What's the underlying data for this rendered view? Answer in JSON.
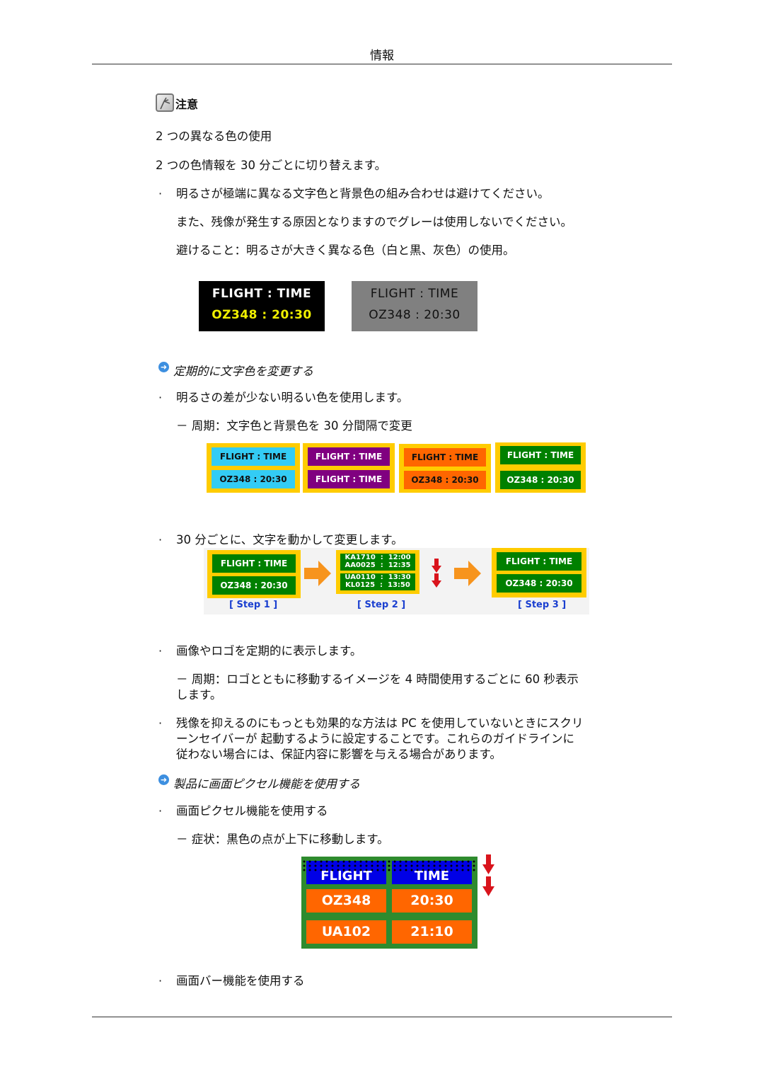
{
  "header": {
    "title": "情報"
  },
  "note": {
    "icon": "note-pencil-icon",
    "label": "注意"
  },
  "intro": {
    "line1": "2 つの異なる色の使用",
    "line2": "2 つの色情報を 30 分ごとに切り替えます。"
  },
  "avoid": {
    "bullet": "·",
    "line1": "明るさが極端に異なる文字色と背景色の組み合わせは避けてください。",
    "line2": "また、残像が発生する原因となりますのでグレーは使用しないでください。",
    "line3": "避けること：明るさが大きく異なる色（白と黒、灰色）の使用。"
  },
  "bad_examples": [
    {
      "row1": "FLIGHT  :  TIME",
      "row2": "OZ348    :  20:30",
      "bg": "#000000",
      "row1_color": "#ffffff",
      "row2_color": "#f0f000"
    },
    {
      "row1": "FLIGHT  :  TIME",
      "row2": "OZ348    :  20:30",
      "bg": "#808080",
      "row1_color": "#111111",
      "row2_color": "#111111"
    }
  ],
  "section1": {
    "icon": "arrow-right-circle-icon",
    "title": "定期的に文字色を変更する",
    "bullet": "·",
    "item": "明るさの差が少ない明るい色を使用します。",
    "sub": "－ 周期：文字色と背景色を 30 分間隔で変更"
  },
  "color_boards": [
    {
      "top": "FLIGHT  :  TIME",
      "bottom": "OZ348    :  20:30",
      "bg": "#33ccf5",
      "fg": "#111111"
    },
    {
      "top": "FLIGHT  :  TIME",
      "bottom": "FLIGHT  :  TIME",
      "bg": "#800080",
      "fg": "#ffffff"
    },
    {
      "top": "FLIGHT  :  TIME",
      "bottom": "OZ348    :  20:30",
      "bg": "#ff6600",
      "fg": "#111111"
    },
    {
      "top": "FLIGHT  :  TIME",
      "bottom": "OZ348    :  20:30",
      "bg": "#008000",
      "fg": "#ffffff"
    }
  ],
  "move": {
    "bullet": "·",
    "item": "30 分ごとに、文字を動かして変更します。",
    "steps": [
      {
        "label": "[ Step 1 ]",
        "top": "FLIGHT  :  TIME",
        "bottom": "OZ348    :  20:30"
      },
      {
        "label": "[ Step 2 ]",
        "top": "KA1710  :  12:00 / AA0025  :  12:35",
        "bottom": "UA0110  :  13:30 / KL0125  :  13:50"
      },
      {
        "label": "[ Step 3 ]",
        "top": "FLIGHT  :  TIME",
        "bottom": "OZ348    :  20:30"
      }
    ]
  },
  "logo": {
    "bullet": "·",
    "item": "画像やロゴを定期的に表示します。",
    "sub_line1": "－ 周期：ロゴとともに移動するイメージを 4 時間使用するごとに 60 秒表示",
    "sub_line2": "します。"
  },
  "screensaver": {
    "bullet": "·",
    "line1": "残像を抑えるのにもっとも効果的な方法は PC を使用していないときにスクリ",
    "line2": "ーンセイバーが 起動するように設定することです。これらのガイドラインに",
    "line3": "従わない場合には、保証内容に影響を与える場合があります。"
  },
  "section2": {
    "icon": "arrow-right-circle-icon",
    "title": "製品に画面ピクセル機能を使用する",
    "bullet": "·",
    "item": "画面ピクセル機能を使用する",
    "sub": "－ 症状：黒色の点が上下に移動します。"
  },
  "pixel_board": {
    "header": [
      "FLIGHT",
      "TIME"
    ],
    "rows": [
      [
        "OZ348",
        "20:30"
      ],
      [
        "UA102",
        "21:10"
      ]
    ]
  },
  "bar": {
    "bullet": "·",
    "item": "画面バー機能を使用する"
  }
}
